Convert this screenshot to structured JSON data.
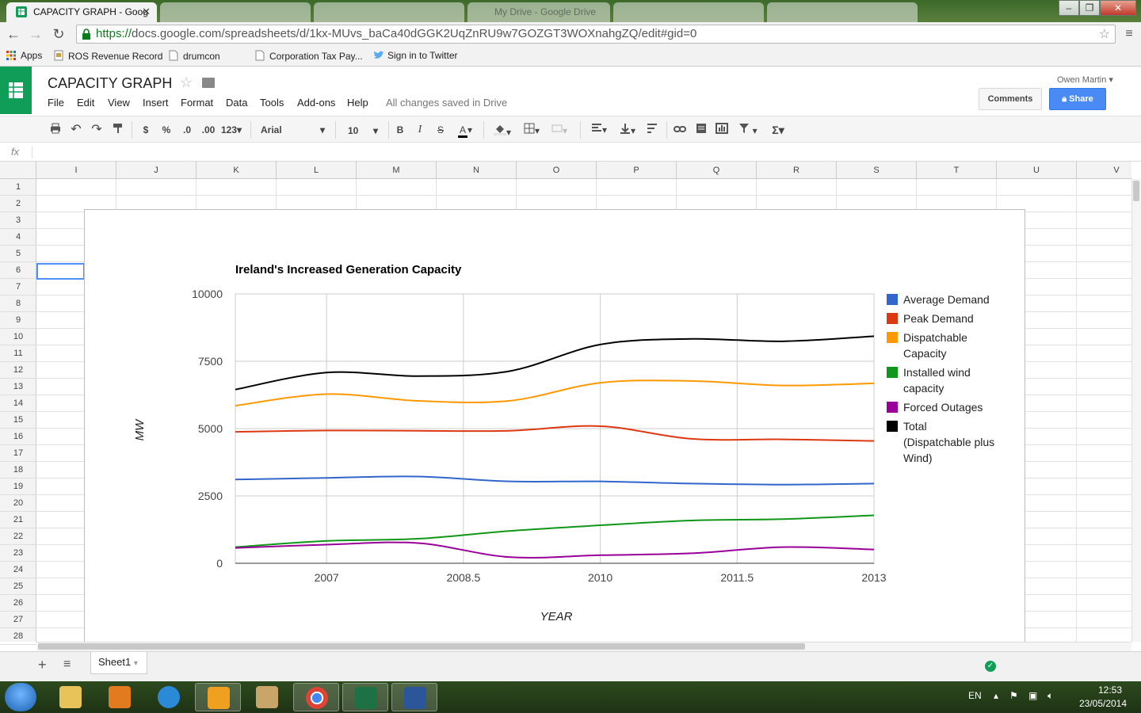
{
  "browser": {
    "tabs": [
      {
        "label": "CAPACITY GRAPH - Goog",
        "active": true
      },
      {
        "label": "",
        "active": false
      },
      {
        "label": "",
        "active": false
      },
      {
        "label": "My Drive - Google Drive",
        "active": false
      },
      {
        "label": "",
        "active": false
      },
      {
        "label": "",
        "active": false
      }
    ],
    "url_prefix": "https://",
    "url_host": "docs.google.com",
    "url_path": "/spreadsheets/d/1kx-MUvs_baCa40dGGK2UqZnRU9w7GOZGT3WOXnahgZQ/edit#gid=0",
    "bookmarks": [
      "Apps",
      "ROS Revenue Record",
      "drumcon",
      "Corporation Tax Pay...",
      "Sign in to Twitter"
    ]
  },
  "sheets": {
    "title": "CAPACITY GRAPH",
    "menu": [
      "File",
      "Edit",
      "View",
      "Insert",
      "Format",
      "Data",
      "Tools",
      "Add-ons",
      "Help"
    ],
    "save_status": "All changes saved in Drive",
    "user": "Owen Martin",
    "comments_label": "Comments",
    "share_label": "Share",
    "toolbar": {
      "currency": "$",
      "percent": "%",
      "dec_less": ".0",
      "dec_more": ".00",
      "number_format": "123",
      "font": "Arial",
      "font_size": "10",
      "bold": "B",
      "italic": "I",
      "strike": "S",
      "text_color": "A",
      "functions": "Σ"
    },
    "fx": "fx",
    "columns": [
      "I",
      "J",
      "K",
      "L",
      "M",
      "N",
      "O",
      "P",
      "Q",
      "R",
      "S",
      "T",
      "U",
      "V"
    ],
    "rows": [
      "1",
      "2",
      "3",
      "4",
      "5",
      "6",
      "7",
      "8",
      "9",
      "10",
      "11",
      "12",
      "13",
      "14",
      "15",
      "16",
      "17",
      "18",
      "19",
      "20",
      "21",
      "22",
      "23",
      "24",
      "25",
      "26",
      "27",
      "28"
    ],
    "selected_cell": "I6",
    "sheet_tab": "Sheet1"
  },
  "chart_data": {
    "type": "line",
    "title": "Ireland's Increased Generation Capacity",
    "xlabel": "YEAR",
    "ylabel": "MW",
    "xlim": [
      2006,
      2013
    ],
    "ylim": [
      0,
      10000
    ],
    "x_ticks": [
      "2007",
      "2008.5",
      "2010",
      "2011.5",
      "2013"
    ],
    "y_ticks": [
      "0",
      "2500",
      "5000",
      "7500",
      "10000"
    ],
    "x_tick_values": [
      2007,
      2008.5,
      2010,
      2011.5,
      2013
    ],
    "y_tick_values": [
      0,
      2500,
      5000,
      7500,
      10000
    ],
    "x": [
      2006,
      2007,
      2008,
      2009,
      2010,
      2011,
      2012,
      2013
    ],
    "legend_position": "right",
    "grid": true,
    "series": [
      {
        "name": "Average Demand",
        "color": "#3366cc",
        "values": [
          3110,
          3170,
          3220,
          3040,
          3040,
          2960,
          2920,
          2960
        ]
      },
      {
        "name": "Peak Demand",
        "color": "#dc3912",
        "values": [
          4880,
          4930,
          4920,
          4920,
          5090,
          4620,
          4600,
          4540
        ]
      },
      {
        "name": "Dispatchable Capacity",
        "color": "#ff9900",
        "values": [
          5850,
          6280,
          6030,
          6030,
          6700,
          6770,
          6600,
          6680
        ]
      },
      {
        "name": "Installed wind capacity",
        "color": "#109618",
        "values": [
          600,
          830,
          910,
          1200,
          1410,
          1590,
          1640,
          1780
        ]
      },
      {
        "name": "Forced Outages",
        "color": "#990099",
        "values": [
          570,
          690,
          750,
          230,
          300,
          370,
          600,
          510
        ]
      },
      {
        "name": "Total (Dispatchable plus Wind)",
        "color": "#000000",
        "values": [
          6450,
          7080,
          6950,
          7130,
          8120,
          8330,
          8240,
          8430
        ]
      }
    ]
  },
  "taskbar": {
    "lang": "EN",
    "time": "12:53",
    "date": "23/05/2014"
  }
}
